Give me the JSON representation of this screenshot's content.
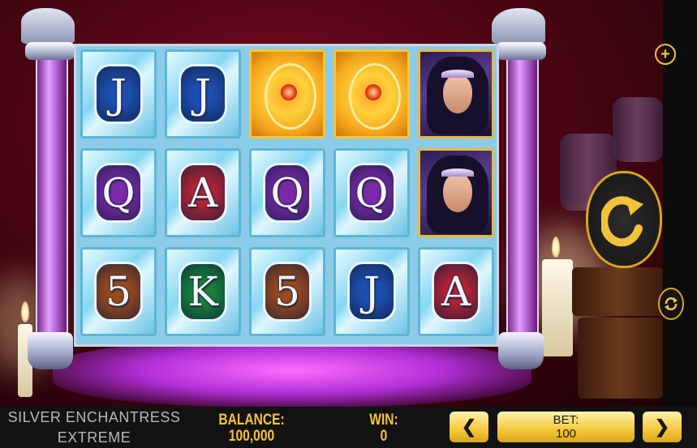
{
  "game": {
    "title_line1": "SILVER ENCHANTRESS",
    "title_line2": "EXTREME"
  },
  "hud": {
    "balance_label": "BALANCE:",
    "balance_value": "100,000",
    "win_label": "WIN:",
    "win_value": "0",
    "bet_label": "BET:",
    "bet_value": "100",
    "prev_bet_glyph": "❮",
    "next_bet_glyph": "❯"
  },
  "controls": {
    "menu_glyph": "+",
    "spin_icon": "spin-arrow-icon",
    "autoplay_icon": "autoplay-icon"
  },
  "colors": {
    "hud_gold": "#f2c33a",
    "hud_bg": "#121212",
    "reel_frame": "#cdd3e5"
  },
  "reels": [
    [
      "J",
      "Q",
      "5"
    ],
    [
      "J",
      "A",
      "K"
    ],
    [
      "scatter",
      "Q",
      "5"
    ],
    [
      "scatter",
      "Q",
      "J"
    ],
    [
      "enchantress",
      "enchantress",
      "A"
    ]
  ],
  "symbol_styles": {
    "J": {
      "color": "#1d4fb0"
    },
    "Q": {
      "color": "#7a2aa8"
    },
    "A": {
      "color": "#b32434"
    },
    "K": {
      "color": "#17823a"
    },
    "5": {
      "color": "#9a4a1e"
    }
  }
}
